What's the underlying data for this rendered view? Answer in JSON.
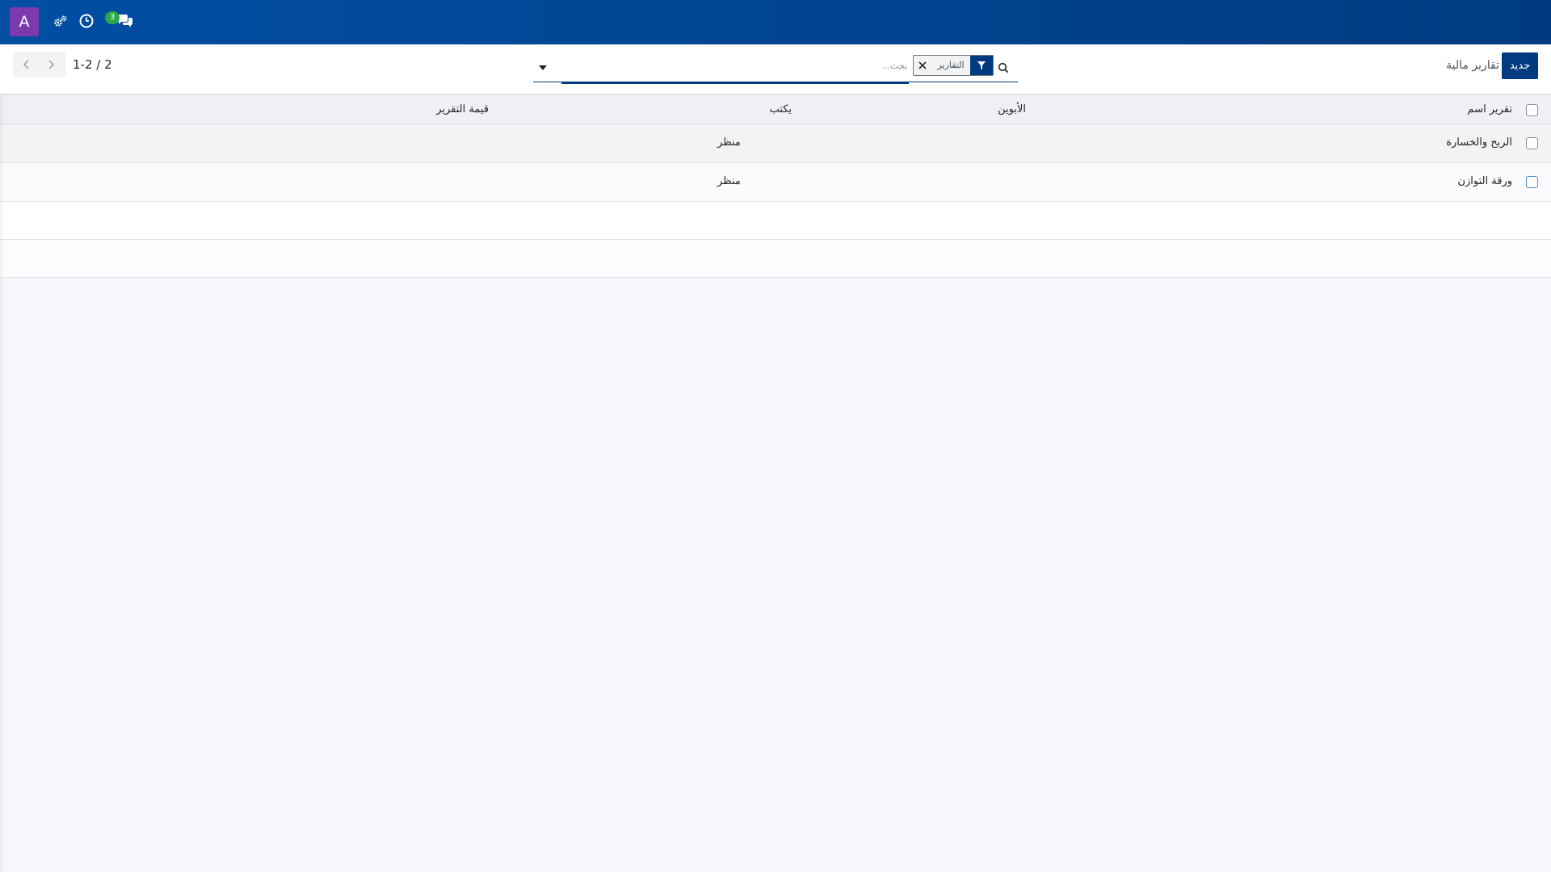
{
  "navbar": {
    "avatar_letter": "A",
    "icons": [
      "settings-gears-icon",
      "clock-icon",
      "chat-icon"
    ],
    "chat_badge": "3"
  },
  "control_panel": {
    "new_button": "جديد",
    "breadcrumb": "تقارير مالية",
    "pager": "1-2 / 2",
    "search": {
      "facet_label": "التقارير",
      "placeholder": "بحث..."
    }
  },
  "list": {
    "headers": {
      "name": "تقرير اسم",
      "parent": "الأبوين",
      "print": "يكتب",
      "value": "قيمة التقرير"
    },
    "rows": [
      {
        "name": "الربح والخسارة",
        "print": "منظر"
      },
      {
        "name": "ورقة التوازن",
        "print": "منظر"
      }
    ]
  },
  "colors": {
    "navbar": "#014ea3",
    "primary": "#003b80",
    "avatar": "#7c3aad",
    "badge": "#28a745"
  }
}
